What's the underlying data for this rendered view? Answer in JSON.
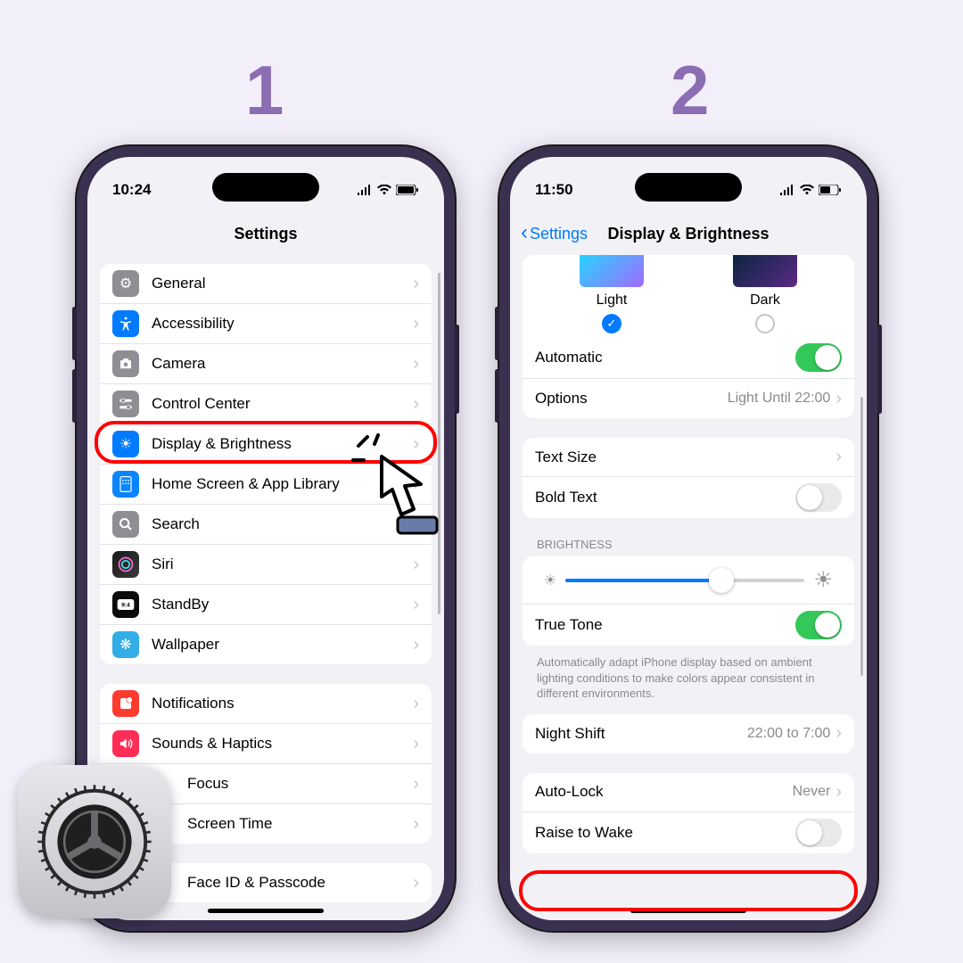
{
  "steps": {
    "one": "1",
    "two": "2"
  },
  "phone1": {
    "time": "10:24",
    "title": "Settings",
    "rows": {
      "general": "General",
      "accessibility": "Accessibility",
      "camera": "Camera",
      "controlCenter": "Control Center",
      "displayBrightness": "Display & Brightness",
      "homeScreen": "Home Screen & App Library",
      "search": "Search",
      "siri": "Siri",
      "standby": "StandBy",
      "wallpaper": "Wallpaper",
      "notifications": "Notifications",
      "sounds": "Sounds & Haptics",
      "focus": "Focus",
      "screenTime": "Screen Time",
      "faceId": "Face ID & Passcode"
    }
  },
  "phone2": {
    "time": "11:50",
    "back": "Settings",
    "title": "Display & Brightness",
    "light": "Light",
    "dark": "Dark",
    "automatic": "Automatic",
    "options": "Options",
    "optionsVal": "Light Until 22:00",
    "textSize": "Text Size",
    "boldText": "Bold Text",
    "brightnessLabel": "Brightness",
    "trueTone": "True Tone",
    "trueToneHint": "Automatically adapt iPhone display based on ambient lighting conditions to make colors appear consistent in different environments.",
    "nightShift": "Night Shift",
    "nightShiftVal": "22:00 to 7:00",
    "autoLock": "Auto-Lock",
    "autoLockVal": "Never",
    "raiseToWake": "Raise to Wake"
  }
}
